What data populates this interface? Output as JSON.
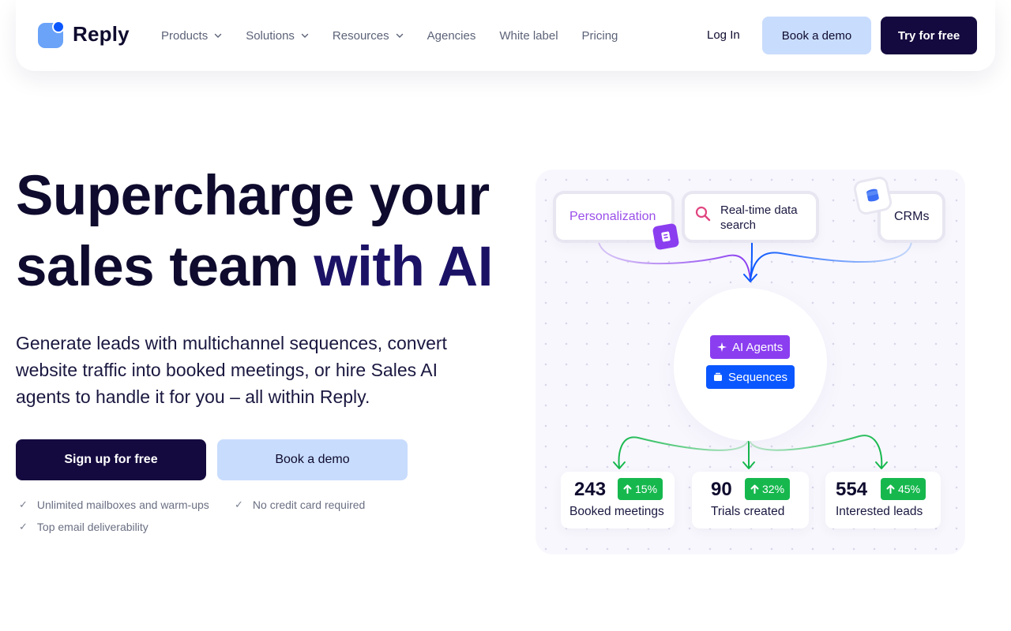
{
  "brand": {
    "name": "Reply"
  },
  "nav": {
    "items": [
      {
        "label": "Products",
        "has_dropdown": true
      },
      {
        "label": "Solutions",
        "has_dropdown": true
      },
      {
        "label": "Resources",
        "has_dropdown": true
      },
      {
        "label": "Agencies",
        "has_dropdown": false
      },
      {
        "label": "White label",
        "has_dropdown": false
      },
      {
        "label": "Pricing",
        "has_dropdown": false
      }
    ],
    "login": "Log In",
    "book_demo": "Book a demo",
    "try_free": "Try for free"
  },
  "hero": {
    "title_line1": "Supercharge your",
    "title_line2_plain": "sales team ",
    "title_line2_accent": "with AI",
    "subtitle": "Generate leads with multichannel sequences, convert website traffic into booked meetings, or hire Sales AI agents to handle it for you – all within Reply.",
    "cta_primary": "Sign up for free",
    "cta_secondary": "Book a demo",
    "features": [
      "Unlimited mailboxes and warm-ups",
      "No credit card required",
      "Top email deliverability"
    ]
  },
  "illustration": {
    "inputs": [
      "Personalization",
      "Real-time data search",
      "CRMs"
    ],
    "hub_items": [
      "AI Agents",
      "Sequences"
    ],
    "stats": [
      {
        "value": "243",
        "change": "15%",
        "label": "Booked meetings"
      },
      {
        "value": "90",
        "change": "32%",
        "label": "Trials created"
      },
      {
        "value": "554",
        "change": "45%",
        "label": "Interested leads"
      }
    ]
  },
  "colors": {
    "dark_navy": "#150a3f",
    "light_blue": "#c8dcfd",
    "purple": "#8b3ef0",
    "blue": "#0b57ff",
    "green": "#16b84e",
    "brand_accent": "#1b1266"
  },
  "icons": [
    "chevron-down-icon",
    "check-icon",
    "search-icon",
    "database-icon",
    "sparkle-icon",
    "stack-icon",
    "arrow-up-icon"
  ]
}
